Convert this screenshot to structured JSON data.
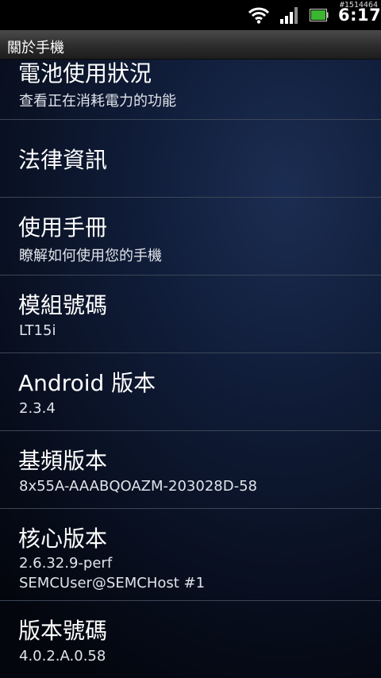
{
  "status_bar": {
    "build_id": "#1514464",
    "time": "6:17",
    "icons": [
      "wifi-icon",
      "signal-strength-icon",
      "battery-icon"
    ],
    "battery_color": "#3cb531"
  },
  "title_bar": {
    "title": "關於手機"
  },
  "settings": [
    {
      "title": "電池使用狀況",
      "summary": "查看正在消耗電力的功能"
    },
    {
      "title": "法律資訊"
    },
    {
      "title": "使用手冊",
      "summary": "瞭解如何使用您的手機"
    },
    {
      "title": "模組號碼",
      "summary": "LT15i"
    },
    {
      "title": "Android 版本",
      "summary": "2.3.4"
    },
    {
      "title": "基頻版本",
      "summary": "8x55A-AAABQOAZM-203028D-58"
    },
    {
      "title": "核心版本",
      "summary_lines": [
        "2.6.32.9-perf",
        "SEMCUser@SEMCHost #1"
      ]
    },
    {
      "title": "版本號碼",
      "summary": "4.0.2.A.0.58"
    }
  ]
}
